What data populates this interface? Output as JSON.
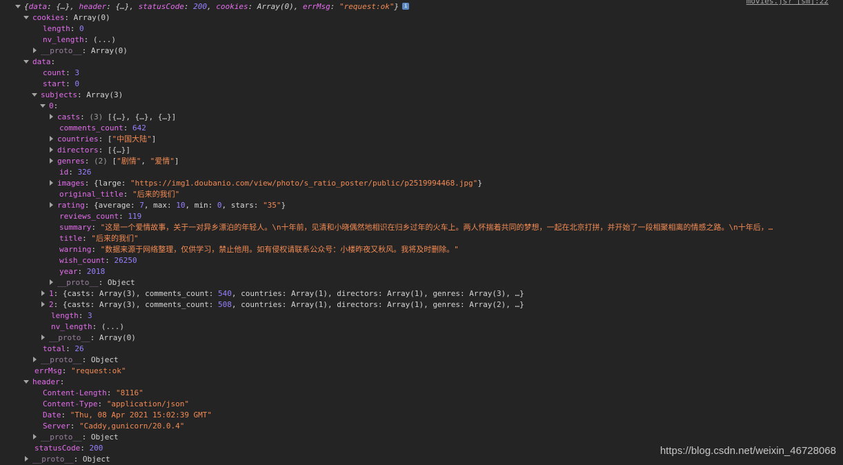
{
  "source_link": "movies.js? [sm]:22",
  "watermark": "https://blog.csdn.net/weixin_46728068",
  "lines": [
    {
      "i": 0,
      "a": "down",
      "italic": true,
      "parts": [
        [
          "p",
          "{"
        ],
        [
          "k",
          "data"
        ],
        [
          "p",
          ": {…}, "
        ],
        [
          "k",
          "header"
        ],
        [
          "p",
          ": {…}, "
        ],
        [
          "k",
          "statusCode"
        ],
        [
          "p",
          ": "
        ],
        [
          "n",
          "200"
        ],
        [
          "p",
          ", "
        ],
        [
          "k",
          "cookies"
        ],
        [
          "p",
          ": Array(0), "
        ],
        [
          "k",
          "errMsg"
        ],
        [
          "p",
          ": "
        ],
        [
          "s",
          "\"request:ok\""
        ],
        [
          "p",
          "}"
        ]
      ],
      "info": "i"
    },
    {
      "i": 1,
      "a": "down",
      "parts": [
        [
          "k",
          "cookies"
        ],
        [
          "p",
          ": Array(0)"
        ]
      ]
    },
    {
      "i": 2,
      "a": "none",
      "parts": [
        [
          "k",
          "length"
        ],
        [
          "p",
          ": "
        ],
        [
          "n",
          "0"
        ]
      ]
    },
    {
      "i": 2,
      "a": "none",
      "parts": [
        [
          "k",
          "nv_length"
        ],
        [
          "p",
          ": (...)"
        ]
      ]
    },
    {
      "i": 2,
      "a": "right",
      "parts": [
        [
          "kp",
          "__proto__"
        ],
        [
          "p",
          ": Array(0)"
        ]
      ]
    },
    {
      "i": 1,
      "a": "down",
      "parts": [
        [
          "k",
          "data"
        ],
        [
          "p",
          ":"
        ]
      ]
    },
    {
      "i": 2,
      "a": "none",
      "parts": [
        [
          "k",
          "count"
        ],
        [
          "p",
          ": "
        ],
        [
          "n",
          "3"
        ]
      ]
    },
    {
      "i": 2,
      "a": "none",
      "parts": [
        [
          "k",
          "start"
        ],
        [
          "p",
          ": "
        ],
        [
          "n",
          "0"
        ]
      ]
    },
    {
      "i": 2,
      "a": "down",
      "parts": [
        [
          "k",
          "subjects"
        ],
        [
          "p",
          ": Array(3)"
        ]
      ]
    },
    {
      "i": 3,
      "a": "down",
      "parts": [
        [
          "k",
          "0"
        ],
        [
          "p",
          ":"
        ]
      ]
    },
    {
      "i": 4,
      "a": "right",
      "parts": [
        [
          "k",
          "casts"
        ],
        [
          "p",
          ": "
        ],
        [
          "d",
          "(3)"
        ],
        [
          "p",
          " [{…}, {…}, {…}]"
        ]
      ]
    },
    {
      "i": 4,
      "a": "none",
      "parts": [
        [
          "k",
          "comments_count"
        ],
        [
          "p",
          ": "
        ],
        [
          "n",
          "642"
        ]
      ]
    },
    {
      "i": 4,
      "a": "right",
      "parts": [
        [
          "k",
          "countries"
        ],
        [
          "p",
          ": ["
        ],
        [
          "s",
          "\"中国大陆\""
        ],
        [
          "p",
          "]"
        ]
      ]
    },
    {
      "i": 4,
      "a": "right",
      "parts": [
        [
          "k",
          "directors"
        ],
        [
          "p",
          ": [{…}]"
        ]
      ]
    },
    {
      "i": 4,
      "a": "right",
      "parts": [
        [
          "k",
          "genres"
        ],
        [
          "p",
          ": "
        ],
        [
          "d",
          "(2)"
        ],
        [
          "p",
          " ["
        ],
        [
          "s",
          "\"剧情\""
        ],
        [
          "p",
          ", "
        ],
        [
          "s",
          "\"爱情\""
        ],
        [
          "p",
          "]"
        ]
      ]
    },
    {
      "i": 4,
      "a": "none",
      "parts": [
        [
          "k",
          "id"
        ],
        [
          "p",
          ": "
        ],
        [
          "n",
          "326"
        ]
      ]
    },
    {
      "i": 4,
      "a": "right",
      "parts": [
        [
          "k",
          "images"
        ],
        [
          "p",
          ": {large: "
        ],
        [
          "s",
          "\"https://img1.doubanio.com/view/photo/s_ratio_poster/public/p2519994468.jpg\""
        ],
        [
          "p",
          "}"
        ]
      ]
    },
    {
      "i": 4,
      "a": "none",
      "parts": [
        [
          "k",
          "original_title"
        ],
        [
          "p",
          ": "
        ],
        [
          "s",
          "\"后来的我们\""
        ]
      ]
    },
    {
      "i": 4,
      "a": "right",
      "parts": [
        [
          "k",
          "rating"
        ],
        [
          "p",
          ": {average: "
        ],
        [
          "n",
          "7"
        ],
        [
          "p",
          ", max: "
        ],
        [
          "n",
          "10"
        ],
        [
          "p",
          ", min: "
        ],
        [
          "n",
          "0"
        ],
        [
          "p",
          ", stars: "
        ],
        [
          "s",
          "\"35\""
        ],
        [
          "p",
          "}"
        ]
      ]
    },
    {
      "i": 4,
      "a": "none",
      "parts": [
        [
          "k",
          "reviews_count"
        ],
        [
          "p",
          ": "
        ],
        [
          "n",
          "119"
        ]
      ]
    },
    {
      "i": 4,
      "a": "none",
      "parts": [
        [
          "k",
          "summary"
        ],
        [
          "p",
          ": "
        ],
        [
          "s",
          "\"这是一个爱情故事，关于一对异乡漂泊的年轻人。\\n十年前，见清和小晓偶然地相识在归乡过年的火车上。两人怀揣着共同的梦想，一起在北京打拼，并开始了一段相聚相离的情感之路。\\n十年后，…"
        ]
      ]
    },
    {
      "i": 4,
      "a": "none",
      "parts": [
        [
          "k",
          "title"
        ],
        [
          "p",
          ": "
        ],
        [
          "s",
          "\"后来的我们\""
        ]
      ]
    },
    {
      "i": 4,
      "a": "none",
      "parts": [
        [
          "k",
          "warning"
        ],
        [
          "p",
          ": "
        ],
        [
          "s",
          "\"数据来源于网络整理，仅供学习，禁止他用。如有侵权请联系公众号：小楼昨夜又秋风。我将及时删除。\""
        ]
      ]
    },
    {
      "i": 4,
      "a": "none",
      "parts": [
        [
          "k",
          "wish_count"
        ],
        [
          "p",
          ": "
        ],
        [
          "n",
          "26250"
        ]
      ]
    },
    {
      "i": 4,
      "a": "none",
      "parts": [
        [
          "k",
          "year"
        ],
        [
          "p",
          ": "
        ],
        [
          "n",
          "2018"
        ]
      ]
    },
    {
      "i": 4,
      "a": "right",
      "parts": [
        [
          "kp",
          "__proto__"
        ],
        [
          "p",
          ": Object"
        ]
      ]
    },
    {
      "i": 3,
      "a": "right",
      "parts": [
        [
          "k",
          "1"
        ],
        [
          "p",
          ": {casts: Array(3), comments_count: "
        ],
        [
          "n",
          "540"
        ],
        [
          "p",
          ", countries: Array(1), directors: Array(1), genres: Array(3), …}"
        ]
      ]
    },
    {
      "i": 3,
      "a": "right",
      "parts": [
        [
          "k",
          "2"
        ],
        [
          "p",
          ": {casts: Array(3), comments_count: "
        ],
        [
          "n",
          "508"
        ],
        [
          "p",
          ", countries: Array(1), directors: Array(1), genres: Array(2), …}"
        ]
      ]
    },
    {
      "i": 3,
      "a": "none",
      "parts": [
        [
          "k",
          "length"
        ],
        [
          "p",
          ": "
        ],
        [
          "n",
          "3"
        ]
      ]
    },
    {
      "i": 3,
      "a": "none",
      "parts": [
        [
          "k",
          "nv_length"
        ],
        [
          "p",
          ": (...)"
        ]
      ]
    },
    {
      "i": 3,
      "a": "right",
      "parts": [
        [
          "kp",
          "__proto__"
        ],
        [
          "p",
          ": Array(0)"
        ]
      ]
    },
    {
      "i": 2,
      "a": "none",
      "parts": [
        [
          "k",
          "total"
        ],
        [
          "p",
          ": "
        ],
        [
          "n",
          "26"
        ]
      ]
    },
    {
      "i": 2,
      "a": "right",
      "parts": [
        [
          "kp",
          "__proto__"
        ],
        [
          "p",
          ": Object"
        ]
      ]
    },
    {
      "i": 1,
      "a": "none",
      "parts": [
        [
          "k",
          "errMsg"
        ],
        [
          "p",
          ": "
        ],
        [
          "s",
          "\"request:ok\""
        ]
      ]
    },
    {
      "i": 1,
      "a": "down",
      "parts": [
        [
          "k",
          "header"
        ],
        [
          "p",
          ":"
        ]
      ]
    },
    {
      "i": 2,
      "a": "none",
      "parts": [
        [
          "k",
          "Content-Length"
        ],
        [
          "p",
          ": "
        ],
        [
          "s",
          "\"8116\""
        ]
      ]
    },
    {
      "i": 2,
      "a": "none",
      "parts": [
        [
          "k",
          "Content-Type"
        ],
        [
          "p",
          ": "
        ],
        [
          "s",
          "\"application/json\""
        ]
      ]
    },
    {
      "i": 2,
      "a": "none",
      "parts": [
        [
          "k",
          "Date"
        ],
        [
          "p",
          ": "
        ],
        [
          "s",
          "\"Thu, 08 Apr 2021 15:02:39 GMT\""
        ]
      ]
    },
    {
      "i": 2,
      "a": "none",
      "parts": [
        [
          "k",
          "Server"
        ],
        [
          "p",
          ": "
        ],
        [
          "s",
          "\"Caddy,gunicorn/20.0.4\""
        ]
      ]
    },
    {
      "i": 2,
      "a": "right",
      "parts": [
        [
          "kp",
          "__proto__"
        ],
        [
          "p",
          ": Object"
        ]
      ]
    },
    {
      "i": 1,
      "a": "none",
      "parts": [
        [
          "k",
          "statusCode"
        ],
        [
          "p",
          ": "
        ],
        [
          "n",
          "200"
        ]
      ]
    },
    {
      "i": 1,
      "a": "right",
      "parts": [
        [
          "kp",
          "__proto__"
        ],
        [
          "p",
          ": Object"
        ]
      ]
    }
  ]
}
